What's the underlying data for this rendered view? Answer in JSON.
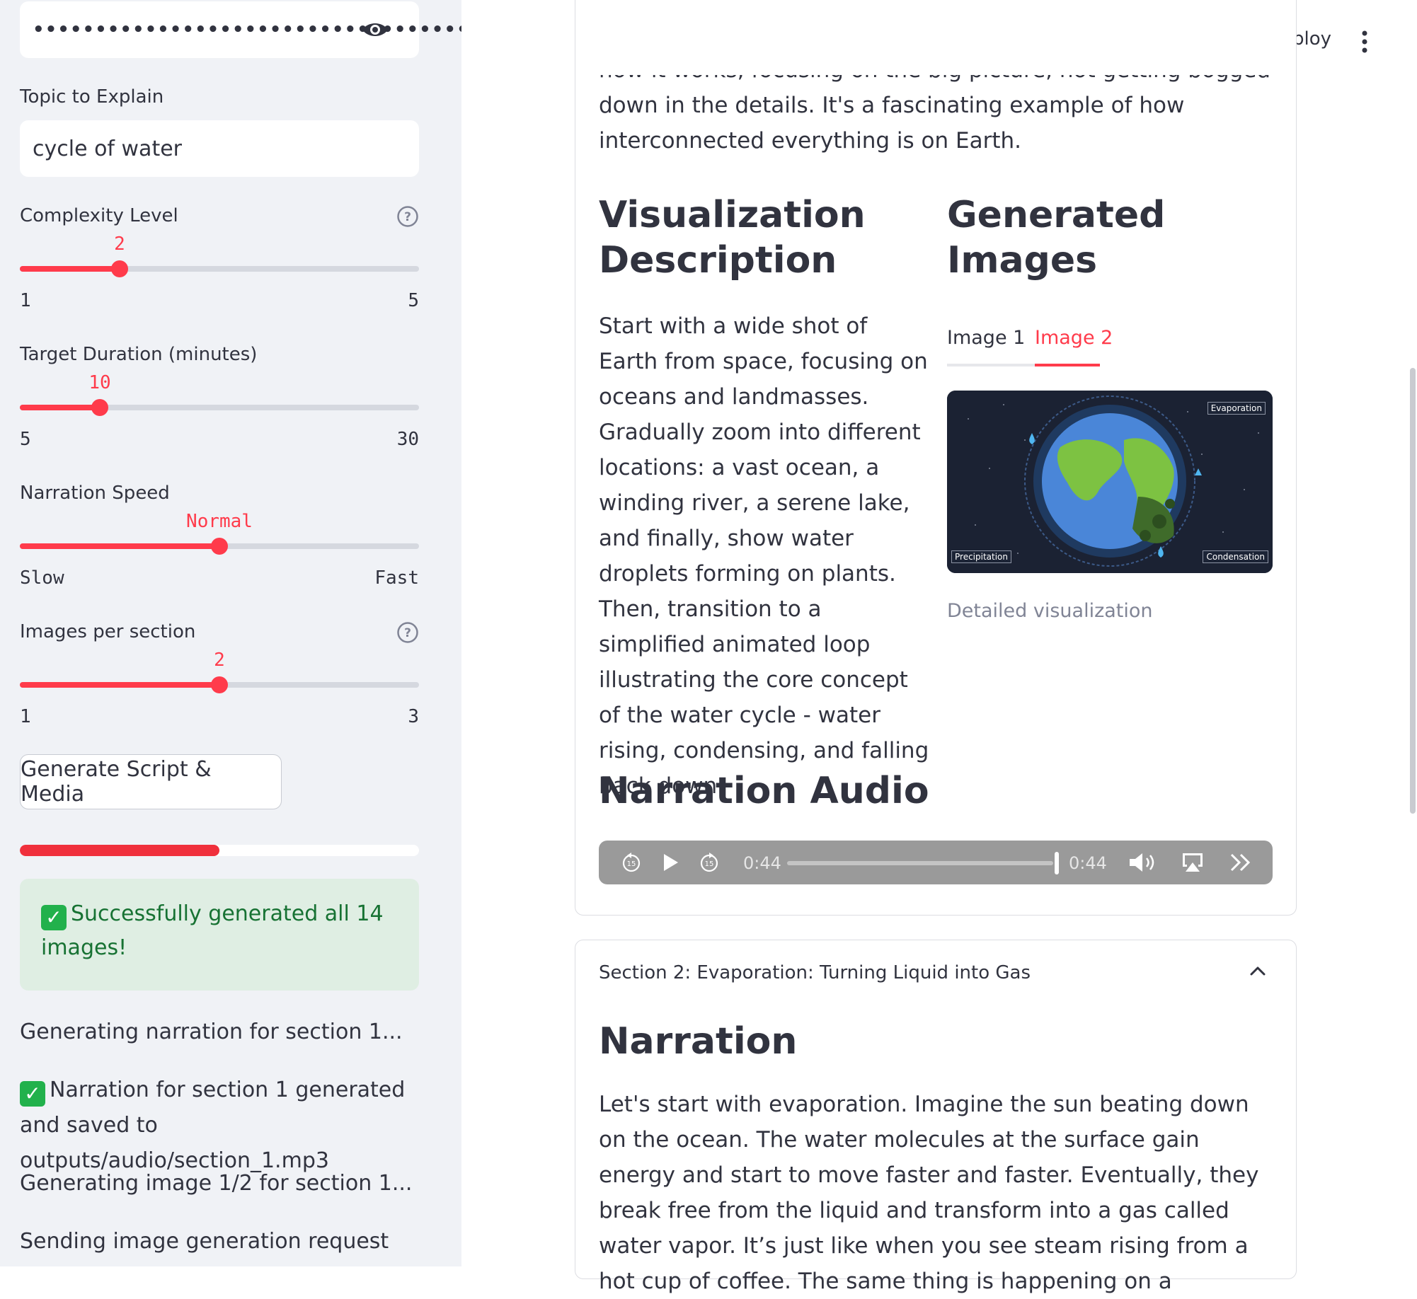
{
  "sidebar": {
    "api_key_value": "••••••••••••••••••••••••••••••••••••••",
    "topic_label": "Topic to Explain",
    "topic_value": "cycle of water",
    "complexity": {
      "label": "Complexity Level",
      "value": "2",
      "min": "1",
      "max": "5",
      "fraction": 0.25
    },
    "duration": {
      "label": "Target Duration (minutes)",
      "value": "10",
      "min": "5",
      "max": "30",
      "fraction": 0.2
    },
    "speed": {
      "label": "Narration Speed",
      "value": "Normal",
      "min": "Slow",
      "max": "Fast",
      "fraction": 0.5
    },
    "images": {
      "label": "Images per section",
      "value": "2",
      "min": "1",
      "max": "3",
      "fraction": 0.5
    },
    "generate_button": "Generate Script & Media",
    "progress": 0.5,
    "success_message": "Successfully generated all 14 images!",
    "logs": [
      "Generating narration for section 1...",
      "Narration for section 1 generated and saved to outputs/audio/section_1.mp3",
      "Generating image 1/2 for section 1...",
      "Sending image generation request"
    ]
  },
  "header": {
    "deploy_label": "Deploy"
  },
  "section1": {
    "intro_text": "how it works, focusing on the big picture, not getting bogged down in the details. It's a fascinating example of how interconnected everything is on Earth.",
    "viz_heading": "Visualization Description",
    "viz_text": "Start with a wide shot of Earth from space, focusing on oceans and landmasses. Gradually zoom into different locations: a vast ocean, a winding river, a serene lake, and finally, show water droplets forming on plants. Then, transition to a simplified animated loop illustrating the core concept of the water cycle - water rising, condensing, and falling back down.",
    "images_heading": "Generated Images",
    "tabs": [
      "Image 1",
      "Image 2"
    ],
    "image_labels": {
      "evaporation": "Evaporation",
      "precipitation": "Precipitation",
      "condensation": "Condensation"
    },
    "image_caption": "Detailed visualization",
    "audio_heading": "Narration Audio",
    "audio": {
      "current_time": "0:44",
      "duration": "0:44",
      "progress": 1.0
    }
  },
  "section2": {
    "header": "Section 2: Evaporation: Turning Liquid into Gas",
    "narration_heading": "Narration",
    "narration_text": "Let's start with evaporation. Imagine the sun beating down on the ocean. The water molecules at the surface gain energy and start to move faster and faster. Eventually, they break free from the liquid and transform into a gas called water vapor. It’s just like when you see steam rising from a hot cup of coffee. The same thing is happening on a"
  },
  "colors": {
    "accent": "#ff3b4b",
    "sidebar_bg": "#f0f2f6",
    "success_bg": "#dfeee3",
    "success_text": "#177233"
  },
  "icons": [
    "eye-icon",
    "help-icon",
    "kebab-menu-icon",
    "skip-back-15-icon",
    "play-icon",
    "skip-forward-15-icon",
    "volume-icon",
    "airplay-icon",
    "playback-rate-icon",
    "chevron-up-icon",
    "check-icon"
  ]
}
